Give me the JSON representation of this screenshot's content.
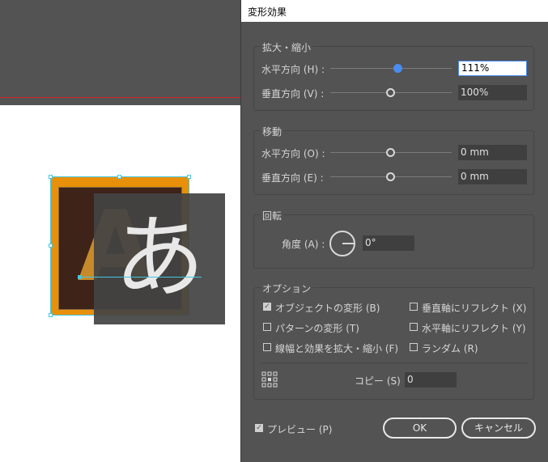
{
  "dialog": {
    "title": "変形効果",
    "scale": {
      "title": "拡大・縮小",
      "horizontal": {
        "label": "水平方向 (H) :",
        "value": "111%",
        "slider_fraction": 0.55
      },
      "vertical": {
        "label": "垂直方向 (V) :",
        "value": "100%",
        "slider_fraction": 0.5
      }
    },
    "move": {
      "title": "移動",
      "horizontal": {
        "label": "水平方向 (O) :",
        "value": "0 mm",
        "slider_fraction": 0.5
      },
      "vertical": {
        "label": "垂直方向 (E) :",
        "value": "0 mm",
        "slider_fraction": 0.5
      }
    },
    "rotate": {
      "title": "回転",
      "angle": {
        "label": "角度 (A) :",
        "value": "0°"
      }
    },
    "options": {
      "title": "オプション",
      "items": [
        {
          "label": "オブジェクトの変形 (B)",
          "checked": true
        },
        {
          "label": "垂直軸にリフレクト (X)",
          "checked": false
        },
        {
          "label": "パターンの変形 (T)",
          "checked": false
        },
        {
          "label": "水平軸にリフレクト (Y)",
          "checked": false
        },
        {
          "label": "線幅と効果を拡大・縮小 (F)",
          "checked": false
        },
        {
          "label": "ランダム (R)",
          "checked": false
        }
      ],
      "copies": {
        "label": "コピー (S)",
        "value": "0"
      }
    },
    "preview": {
      "label": "プレビュー (P)",
      "checked": true
    },
    "ok_label": "OK",
    "cancel_label": "キャンセル"
  },
  "canvas": {
    "logo_letter": "A",
    "ghost_char": "あ",
    "colors": {
      "pasteboard": "#535353",
      "bleed": "#d0252b",
      "orange": "#e8900a",
      "brown": "#3e2318",
      "selection": "#41c7e0"
    }
  }
}
